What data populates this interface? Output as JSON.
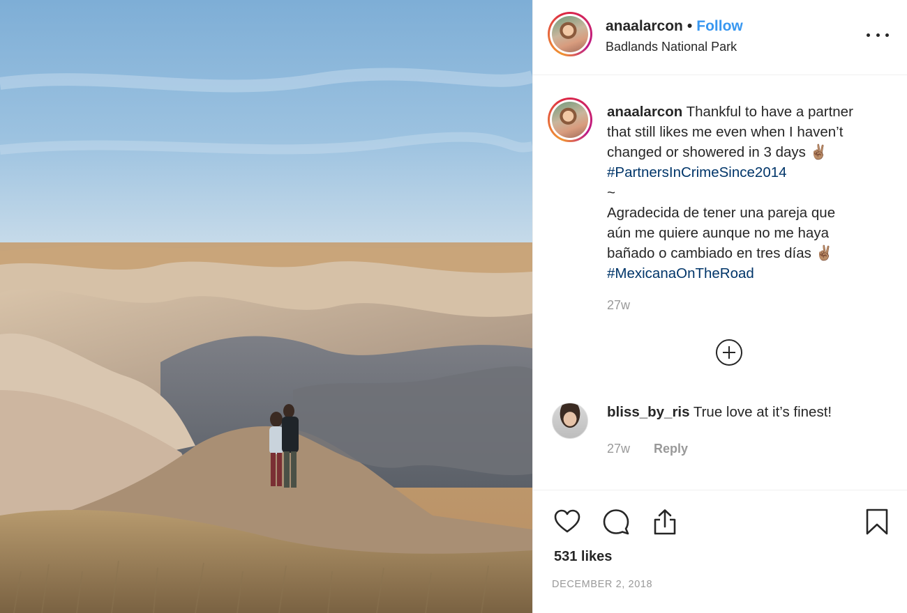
{
  "header": {
    "username": "anaalarcon",
    "separator": "•",
    "follow_label": "Follow",
    "location": "Badlands National Park"
  },
  "caption": {
    "username": "anaalarcon",
    "line1_text": "Thankful to have a partner",
    "line2": "that still likes me even when I haven’t",
    "line3": "changed or showered in 3 days ✌🏽",
    "hashtag1": "#PartnersInCrimeSince2014",
    "tilde": "~",
    "line5": "Agradecida de tener una pareja que",
    "line6": "aún me quiere aunque no me haya",
    "line7": "bañado o cambiado en tres días ✌🏽",
    "hashtag2": "#MexicanaOnTheRoad",
    "time": "27w"
  },
  "comments": [
    {
      "username": "bliss_by_ris",
      "text": "True love at it’s finest!",
      "time": "27w",
      "reply_label": "Reply"
    }
  ],
  "actions": {
    "likes": "531 likes",
    "date": "DECEMBER 2, 2018"
  },
  "icons": {
    "more": "more-options-icon",
    "load_more": "plus-circle-icon",
    "like": "heart-icon",
    "comment": "comment-icon",
    "share": "share-icon",
    "save": "bookmark-icon"
  },
  "colors": {
    "link_blue": "#3897f0",
    "hashtag": "#003569",
    "muted": "#999999",
    "text": "#262626"
  }
}
